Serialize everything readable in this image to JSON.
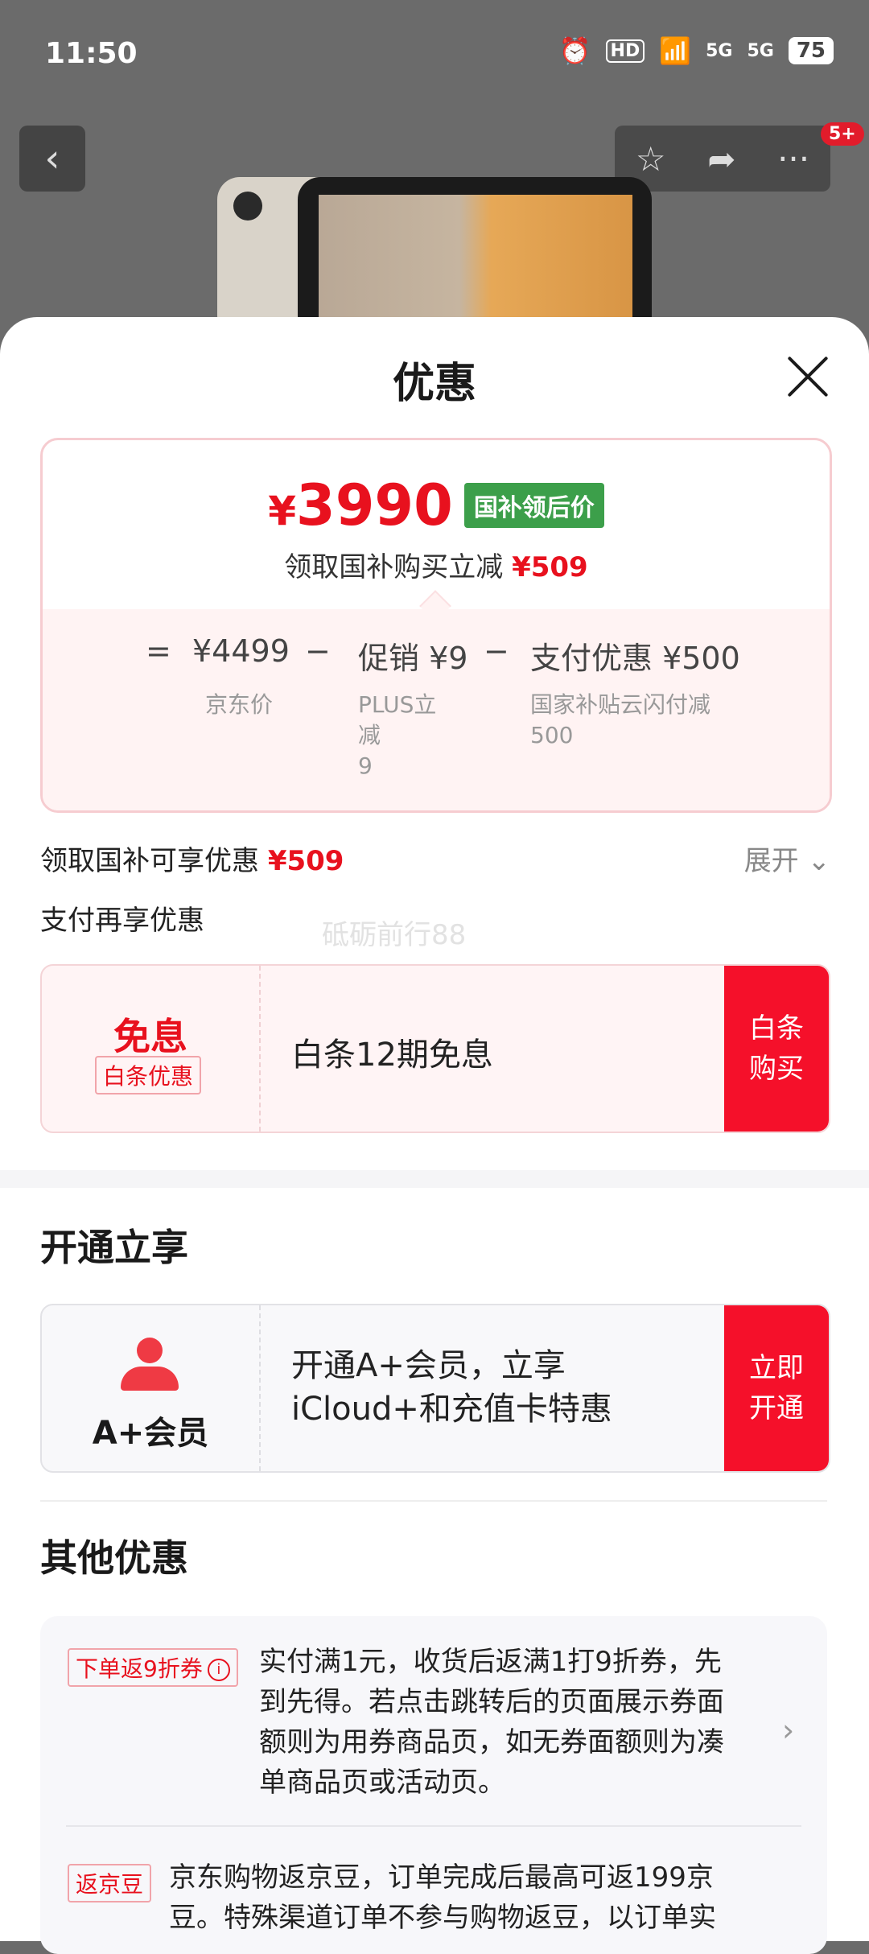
{
  "status_bar": {
    "time": "11:50",
    "hd": "HD",
    "net1": "5G",
    "net2": "5G",
    "battery": "75"
  },
  "header": {
    "notification_count": "5+"
  },
  "sheet": {
    "title": "优惠",
    "price_card": {
      "price_symbol": "¥",
      "price": "3990",
      "tag": "国补领后价",
      "sub_prefix": "领取国补购买立减",
      "sub_amount": "¥509",
      "calc": {
        "eq": "=",
        "jd_price": "¥4499",
        "minus1": "−",
        "promo": "促销 ¥9",
        "minus2": "−",
        "pay_discount": "支付优惠 ¥500",
        "jd_price_label": "京东价",
        "promo_label_line1": "PLUS立",
        "promo_label_line2": "减",
        "promo_label_line3": "9",
        "pay_label_line1": "国家补贴云闪付减",
        "pay_label_line2": "500"
      }
    },
    "subsidy_row": {
      "label": "领取国补可享优惠",
      "amount": "¥509",
      "expand": "展开"
    },
    "pay_again_label": "支付再享优惠",
    "watermark": "砥砺前行88",
    "pay_card": {
      "title": "免息",
      "tag": "白条优惠",
      "desc": "白条12期免息",
      "button_line1": "白条",
      "button_line2": "购买"
    },
    "membership": {
      "section_title": "开通立享",
      "label": "A+会员",
      "desc_line1": "开通A+会员，立享",
      "desc_line2": "iCloud+和充值卡特惠",
      "button_line1": "立即",
      "button_line2": "开通"
    },
    "other": {
      "section_title": "其他优惠",
      "items": [
        {
          "tag": "下单返9折券",
          "text_line1": "实付满1元，收货后返满1打9折券，先",
          "text_line2": "到先得。若点击跳转后的页面展示券面",
          "text_line3": "额则为用券商品页，如无券面额则为凑",
          "text_line4": "单商品页或活动页。"
        },
        {
          "tag": "返京豆",
          "text_line1": "京东购物返京豆，订单完成后最高可返199京",
          "text_line2": "豆。特殊渠道订单不参与购物返豆，以订单实"
        }
      ]
    }
  }
}
